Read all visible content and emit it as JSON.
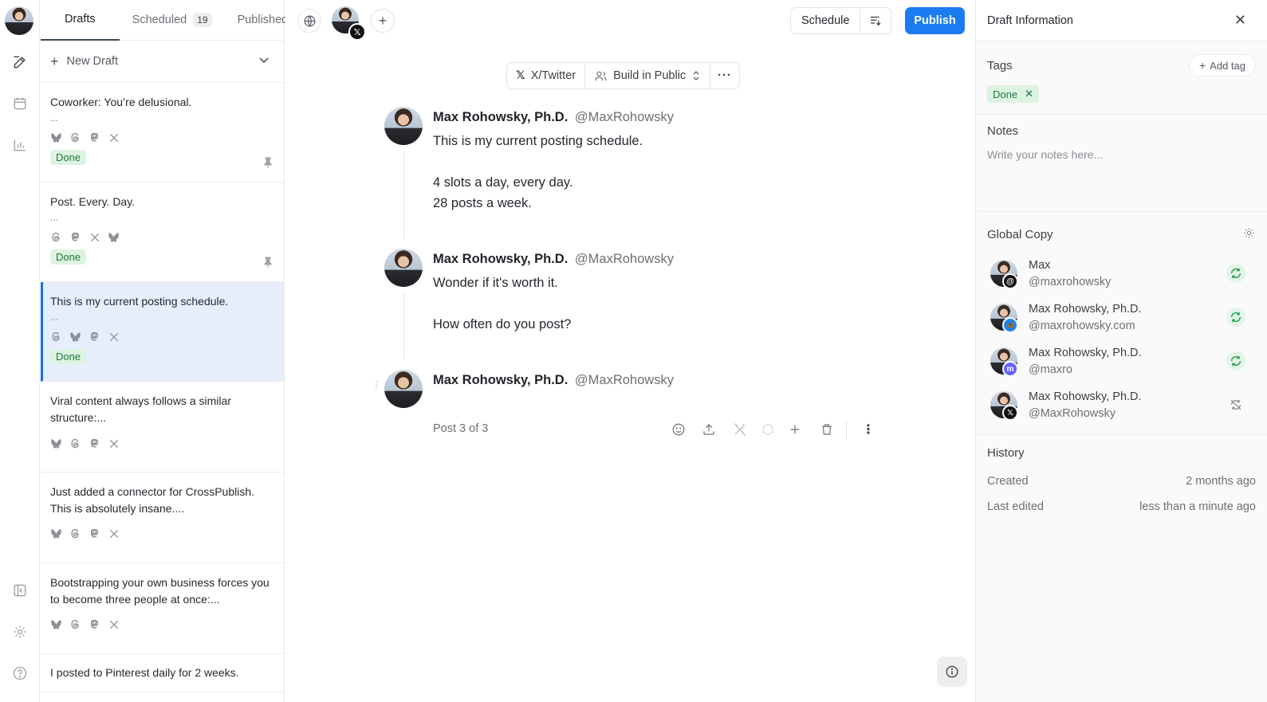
{
  "tabs": {
    "drafts": "Drafts",
    "scheduled": "Scheduled",
    "scheduled_count": "19",
    "published": "Published"
  },
  "new_draft_label": "New Draft",
  "drafts": [
    {
      "title": "Coworker: You’re delusional.",
      "dots": "...",
      "networks": [
        "bluesky",
        "threads",
        "mastodon",
        "x"
      ],
      "tag": "Done",
      "pinned": true
    },
    {
      "title": "Post. Every. Day.",
      "dots": "...",
      "networks": [
        "threads",
        "mastodon",
        "x",
        "bluesky"
      ],
      "tag": "Done",
      "pinned": true
    },
    {
      "title": "This is my current posting schedule.",
      "dots": "...",
      "networks": [
        "threads",
        "bluesky",
        "mastodon",
        "x"
      ],
      "tag": "Done",
      "pinned": false,
      "selected": true
    },
    {
      "title": "Viral content always follows a similar structure:...",
      "dots": "",
      "networks": [
        "bluesky",
        "threads",
        "mastodon",
        "x"
      ],
      "tag": "",
      "pinned": false
    },
    {
      "title": "Just added a connector for CrossPublish. This is absolutely insane....",
      "dots": "",
      "networks": [
        "bluesky",
        "threads",
        "mastodon",
        "x"
      ],
      "tag": "",
      "pinned": false
    },
    {
      "title": "Bootstrapping your own business forces you to become three people at once:...",
      "dots": "",
      "networks": [
        "bluesky",
        "threads",
        "mastodon",
        "x"
      ],
      "tag": "",
      "pinned": false
    },
    {
      "title": "I posted to Pinterest daily for 2 weeks.",
      "dots": "",
      "networks": [],
      "tag": "",
      "pinned": false
    }
  ],
  "toolbar": {
    "schedule_label": "Schedule",
    "publish_label": "Publish"
  },
  "pillbar": {
    "platform": "X/Twitter",
    "workspace": "Build in Public"
  },
  "posts": [
    {
      "name": "Max Rohowsky, Ph.D.",
      "handle": "@MaxRohowsky",
      "body": "This is my current posting schedule.\n\n4 slots a day, every day.\n28 posts a week."
    },
    {
      "name": "Max Rohowsky, Ph.D.",
      "handle": "@MaxRohowsky",
      "body": "Wonder if it's worth it.\n\nHow often do you post?"
    },
    {
      "name": "Max Rohowsky, Ph.D.",
      "handle": "@MaxRohowsky",
      "body": ""
    }
  ],
  "post_meta": "Post 3 of 3",
  "panel": {
    "title": "Draft Information",
    "tags_label": "Tags",
    "add_tag_label": "Add tag",
    "tag": "Done",
    "notes_label": "Notes",
    "notes_placeholder": "Write your notes here...",
    "global_copy_label": "Global Copy",
    "accounts": [
      {
        "name": "Max",
        "handle": "@maxrohowsky",
        "network": "threads",
        "synced": true
      },
      {
        "name": "Max Rohowsky, Ph.D.",
        "handle": "@maxrohowsky.com",
        "network": "bluesky",
        "synced": true
      },
      {
        "name": "Max Rohowsky, Ph.D.",
        "handle": "@maxro",
        "network": "mastodon",
        "synced": true
      },
      {
        "name": "Max Rohowsky, Ph.D.",
        "handle": "@MaxRohowsky",
        "network": "x",
        "synced": false
      }
    ],
    "history_label": "History",
    "created_label": "Created",
    "created_value": "2 months ago",
    "edited_label": "Last edited",
    "edited_value": "less than a minute ago"
  },
  "colors": {
    "accent": "#1a7cf0",
    "done_bg": "#ddf3e2",
    "done_fg": "#1d7a3a",
    "selected_bg": "#e6eefb"
  }
}
